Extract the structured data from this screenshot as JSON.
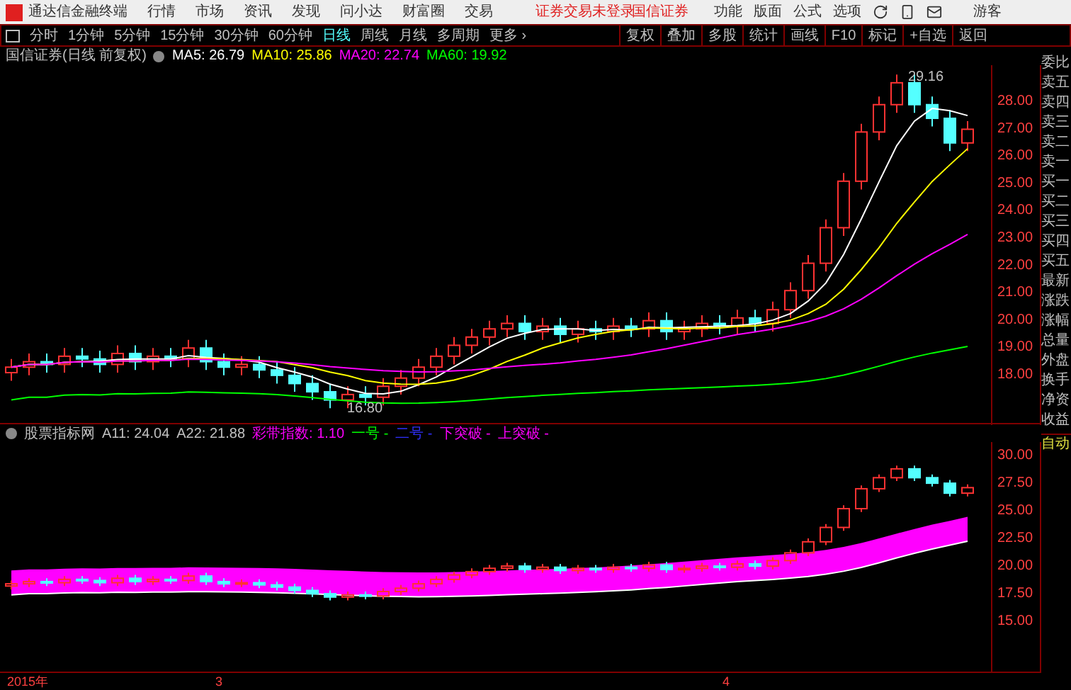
{
  "app": {
    "title": "通达信金融终端"
  },
  "menu": [
    "行情",
    "市场",
    "资讯",
    "发现",
    "问小达",
    "财富圈",
    "交易"
  ],
  "login_notice": "证券交易未登录",
  "broker": "国信证券",
  "top_menu": [
    "功能",
    "版面",
    "公式",
    "选项"
  ],
  "user": "游客",
  "periods": [
    {
      "label": "分时",
      "selected": false
    },
    {
      "label": "1分钟",
      "selected": false
    },
    {
      "label": "5分钟",
      "selected": false
    },
    {
      "label": "15分钟",
      "selected": false
    },
    {
      "label": "30分钟",
      "selected": false
    },
    {
      "label": "60分钟",
      "selected": false
    },
    {
      "label": "日线",
      "selected": true
    },
    {
      "label": "周线",
      "selected": false
    },
    {
      "label": "月线",
      "selected": false
    },
    {
      "label": "多周期",
      "selected": false
    },
    {
      "label": "更多 ›",
      "selected": false
    }
  ],
  "chart_tools": [
    "复权",
    "叠加",
    "多股",
    "统计",
    "画线",
    "F10",
    "标记",
    "+自选",
    "返回"
  ],
  "main_chart": {
    "title": "国信证券(日线 前复权)",
    "indicators": [
      {
        "label": "MA5: 26.79",
        "color": "#ffffff"
      },
      {
        "label": "MA10: 25.86",
        "color": "#ffff00"
      },
      {
        "label": "MA20: 22.74",
        "color": "#ff00ff"
      },
      {
        "label": "MA60: 19.92",
        "color": "#00ff00"
      }
    ],
    "high_label": "29.16",
    "low_label": "16.80",
    "axis": [
      "28.00",
      "27.00",
      "26.00",
      "25.00",
      "24.00",
      "23.00",
      "22.00",
      "21.00",
      "20.00",
      "19.00",
      "18.00"
    ]
  },
  "sub_chart": {
    "title": "股票指标网",
    "values": [
      {
        "label": "A11: 24.04",
        "color": "#c0c0c0"
      },
      {
        "label": "A22: 21.88",
        "color": "#c0c0c0"
      },
      {
        "label": "彩带指数: 1.10",
        "color": "#ff00ff"
      },
      {
        "label": "一号 -",
        "color": "#00ff00"
      },
      {
        "label": "二号 -",
        "color": "#3030ff"
      },
      {
        "label": "下突破 -",
        "color": "#ff00ff"
      },
      {
        "label": "上突破 -",
        "color": "#ff00ff"
      }
    ],
    "axis": [
      "30.00",
      "27.50",
      "25.00",
      "22.50",
      "20.00",
      "17.50",
      "15.00"
    ]
  },
  "date_axis": [
    "2015年",
    "3",
    "4"
  ],
  "quote_panel": [
    "委比",
    "卖五",
    "卖四",
    "卖三",
    "卖二",
    "卖一",
    "买一",
    "买二",
    "买三",
    "买四",
    "买五",
    "最新",
    "涨跌",
    "涨幅",
    "总量",
    "外盘",
    "换手",
    "净资",
    "收益"
  ],
  "auto_label": "自动"
}
